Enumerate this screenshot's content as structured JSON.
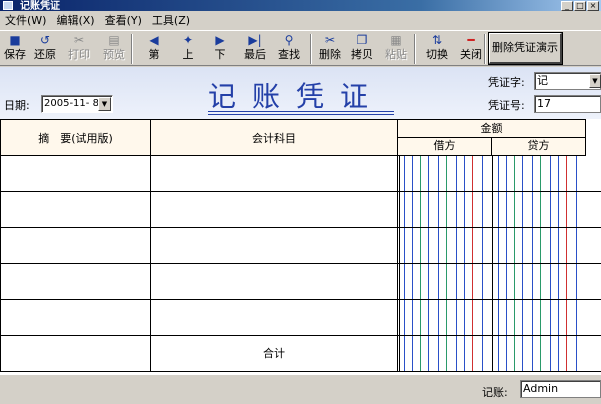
{
  "window": {
    "title": "记账凭证"
  },
  "menu": [
    "文件(W)",
    "编辑(X)",
    "查看(Y)",
    "工具(Z)"
  ],
  "toolbar": {
    "buttons": [
      {
        "label": "保存",
        "icon": "floppy-icon",
        "glyph": "■",
        "enabled": true
      },
      {
        "label": "还原",
        "icon": "undo-icon",
        "glyph": "↺",
        "enabled": true
      },
      {
        "label": "打印",
        "icon": "print-icon",
        "glyph": "✂",
        "enabled": false
      },
      {
        "label": "预览",
        "icon": "preview-icon",
        "glyph": "▤",
        "enabled": false
      },
      {
        "label": "第",
        "icon": "first-icon",
        "glyph": "◀",
        "enabled": true
      },
      {
        "label": "上",
        "icon": "prev-icon",
        "glyph": "✦",
        "enabled": true
      },
      {
        "label": "下",
        "icon": "next-icon",
        "glyph": "▶",
        "enabled": true
      },
      {
        "label": "最后",
        "icon": "last-icon",
        "glyph": "▶|",
        "enabled": true
      },
      {
        "label": "查找",
        "icon": "binoculars-icon",
        "glyph": "⚲",
        "enabled": true
      },
      {
        "label": "删除",
        "icon": "cut-icon",
        "glyph": "✂",
        "enabled": true
      },
      {
        "label": "拷贝",
        "icon": "copy-icon",
        "glyph": "❐",
        "enabled": true
      },
      {
        "label": "粘贴",
        "icon": "paste-icon",
        "glyph": "▦",
        "enabled": false
      },
      {
        "label": "切换",
        "icon": "switch-icon",
        "glyph": "⇅",
        "enabled": true
      },
      {
        "label": "关闭",
        "icon": "close-icon",
        "glyph": "━",
        "enabled": true
      }
    ],
    "demo_button": "删除凭证演示"
  },
  "voucher": {
    "title": "记账凭证",
    "date_label": "日期:",
    "date_value": "2005-11- 8",
    "type_label": "凭证字:",
    "type_value": "记",
    "number_label": "凭证号:",
    "number_value": "17"
  },
  "table": {
    "summary_header": "摘　要(试用版)",
    "account_header": "会计科目",
    "amount_header": "金额",
    "debit_header": "借方",
    "credit_header": "贷方",
    "total_label": "合计",
    "rows": 5
  },
  "footer": {
    "bookkeeper_label": "记账:",
    "bookkeeper_value": "Admin"
  },
  "colors": {
    "title": "#2440a8",
    "grid_blue": "#2a50c8",
    "grid_green": "#2a9a6a",
    "grid_red": "#d03030"
  }
}
